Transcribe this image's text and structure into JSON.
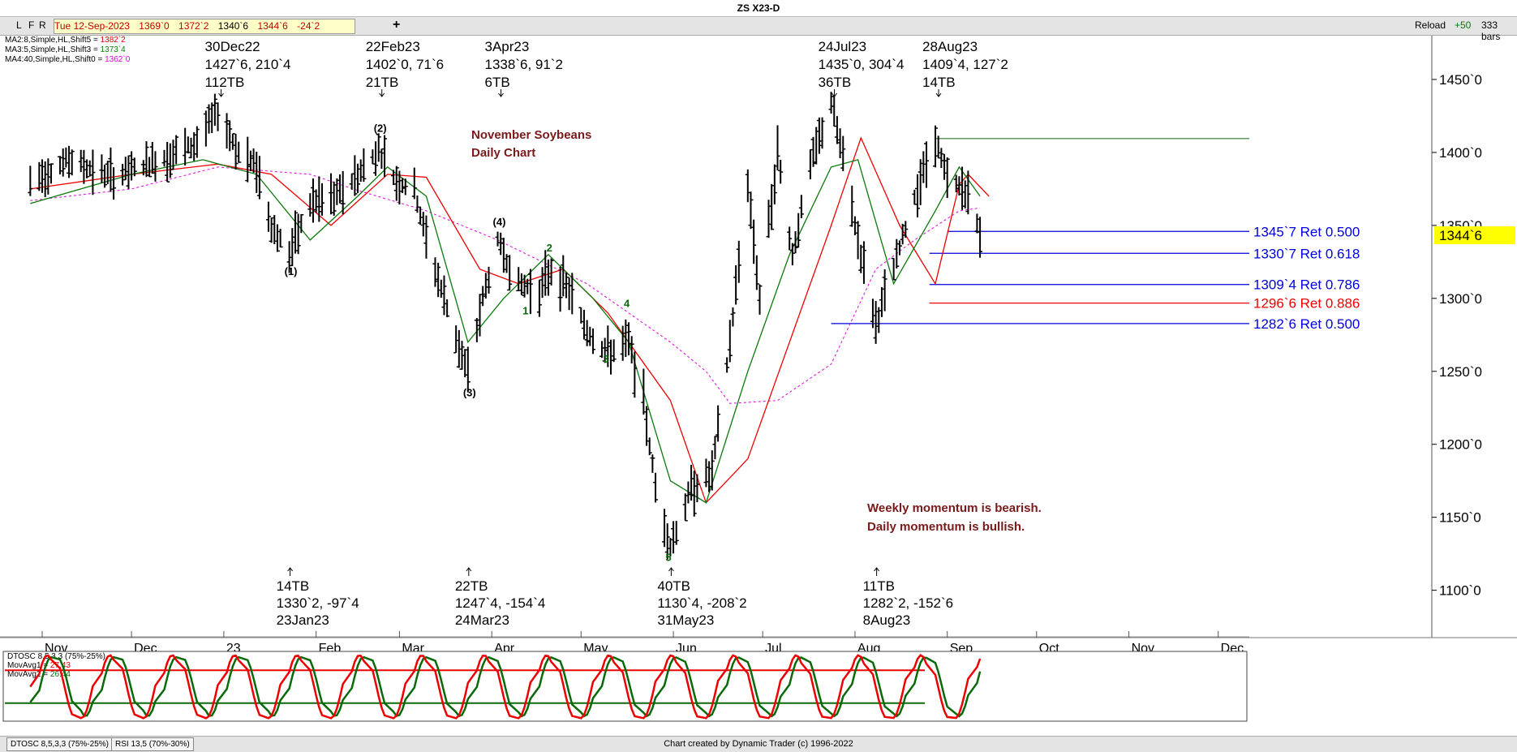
{
  "window": {
    "title": "ZS X23-D"
  },
  "toolbar": {
    "buttons": [
      "L",
      "F",
      "R"
    ],
    "date": "Tue 12-Sep-2023",
    "open": "1369`0",
    "high": "1372`2",
    "low": "1340`6",
    "close": "1344`6",
    "change": "-24`2",
    "add_label": "+",
    "reload_label": "Reload",
    "plus50": "+50",
    "bars_label": "333 bars"
  },
  "legend": {
    "ma2": {
      "label": "MA2:8,Simple,HL,Shift5",
      "value": "1382`2",
      "color": "#e00000"
    },
    "ma3": {
      "label": "MA3:5,Simple,HL,Shift3",
      "value": "1373`4",
      "color": "#0a7a0a"
    },
    "ma4": {
      "label": "MA4:40,Simple,HL,Shift0",
      "value": "1362`0",
      "color": "#e000e0"
    }
  },
  "chart_data": {
    "type": "line",
    "title": "ZS X23-D",
    "subtitle": "November Soybeans Daily Chart",
    "annotation_lines": [
      "November Soybeans",
      "Daily Chart"
    ],
    "ylim": [
      1092,
      1480
    ],
    "yticks": [
      "1450`0",
      "1400`0",
      "1350`0",
      "1300`0",
      "1250`0",
      "1200`0",
      "1150`0",
      "1100`0"
    ],
    "ytick_values": [
      1450,
      1400,
      1350,
      1300,
      1250,
      1200,
      1150,
      1100
    ],
    "months": [
      "Nov",
      "Dec",
      "23",
      "Feb",
      "Mar",
      "Apr",
      "May",
      "Jun",
      "Jul",
      "Aug",
      "Sep",
      "Oct",
      "Nov",
      "Dec"
    ],
    "current_price": "1344`6",
    "price_path": [
      [
        "2022-10-28",
        1380
      ],
      [
        "2022-11-10",
        1395
      ],
      [
        "2022-11-25",
        1383
      ],
      [
        "2022-12-10",
        1395
      ],
      [
        "2022-12-22",
        1405
      ],
      [
        "2022-12-30",
        1427.75
      ],
      [
        "2023-01-06",
        1400
      ],
      [
        "2023-01-12",
        1390
      ],
      [
        "2023-01-17",
        1350
      ],
      [
        "2023-01-23",
        1330.25
      ],
      [
        "2023-01-30",
        1365
      ],
      [
        "2023-02-08",
        1370
      ],
      [
        "2023-02-15",
        1385
      ],
      [
        "2023-02-22",
        1402
      ],
      [
        "2023-02-28",
        1380
      ],
      [
        "2023-03-06",
        1375
      ],
      [
        "2023-03-10",
        1340
      ],
      [
        "2023-03-16",
        1300
      ],
      [
        "2023-03-24",
        1247.5
      ],
      [
        "2023-03-29",
        1300
      ],
      [
        "2023-04-03",
        1338.75
      ],
      [
        "2023-04-10",
        1310
      ],
      [
        "2023-04-17",
        1305
      ],
      [
        "2023-04-21",
        1320
      ],
      [
        "2023-04-27",
        1305
      ],
      [
        "2023-05-03",
        1278
      ],
      [
        "2023-05-10",
        1262
      ],
      [
        "2023-05-17",
        1270
      ],
      [
        "2023-05-22",
        1230
      ],
      [
        "2023-05-26",
        1170
      ],
      [
        "2023-05-31",
        1130.5
      ],
      [
        "2023-06-07",
        1170
      ],
      [
        "2023-06-14",
        1180
      ],
      [
        "2023-06-20",
        1270
      ],
      [
        "2023-06-26",
        1380
      ],
      [
        "2023-06-30",
        1300
      ],
      [
        "2023-07-06",
        1400
      ],
      [
        "2023-07-11",
        1330
      ],
      [
        "2023-07-17",
        1390
      ],
      [
        "2023-07-24",
        1435
      ],
      [
        "2023-07-28",
        1395
      ],
      [
        "2023-08-02",
        1340
      ],
      [
        "2023-08-08",
        1282.25
      ],
      [
        "2023-08-14",
        1320
      ],
      [
        "2023-08-21",
        1370
      ],
      [
        "2023-08-28",
        1409.5
      ],
      [
        "2023-09-01",
        1380
      ],
      [
        "2023-09-07",
        1375
      ],
      [
        "2023-09-12",
        1344.75
      ]
    ],
    "ma_fast_path": [
      [
        "2022-10-28",
        1365
      ],
      [
        "2022-12-01",
        1385
      ],
      [
        "2022-12-25",
        1395
      ],
      [
        "2023-01-12",
        1385
      ],
      [
        "2023-01-30",
        1340
      ],
      [
        "2023-02-15",
        1370
      ],
      [
        "2023-02-25",
        1390
      ],
      [
        "2023-03-10",
        1370
      ],
      [
        "2023-03-24",
        1270
      ],
      [
        "2023-04-05",
        1300
      ],
      [
        "2023-04-20",
        1330
      ],
      [
        "2023-05-05",
        1300
      ],
      [
        "2023-05-17",
        1270
      ],
      [
        "2023-05-31",
        1175
      ],
      [
        "2023-06-12",
        1160
      ],
      [
        "2023-06-26",
        1250
      ],
      [
        "2023-07-10",
        1330
      ],
      [
        "2023-07-24",
        1390
      ],
      [
        "2023-08-02",
        1395
      ],
      [
        "2023-08-14",
        1310
      ],
      [
        "2023-08-28",
        1360
      ],
      [
        "2023-09-05",
        1390
      ],
      [
        "2023-09-12",
        1370
      ]
    ],
    "ma_slow_path": [
      [
        "2022-10-28",
        1375
      ],
      [
        "2022-12-01",
        1385
      ],
      [
        "2022-12-30",
        1392
      ],
      [
        "2023-01-17",
        1385
      ],
      [
        "2023-02-06",
        1350
      ],
      [
        "2023-02-25",
        1385
      ],
      [
        "2023-03-10",
        1383
      ],
      [
        "2023-03-28",
        1320
      ],
      [
        "2023-04-10",
        1310
      ],
      [
        "2023-04-25",
        1320
      ],
      [
        "2023-05-10",
        1290
      ],
      [
        "2023-05-31",
        1230
      ],
      [
        "2023-06-12",
        1160
      ],
      [
        "2023-06-26",
        1190
      ],
      [
        "2023-07-10",
        1270
      ],
      [
        "2023-07-24",
        1350
      ],
      [
        "2023-08-03",
        1410
      ],
      [
        "2023-08-16",
        1350
      ],
      [
        "2023-08-28",
        1310
      ],
      [
        "2023-09-05",
        1378
      ],
      [
        "2023-09-08",
        1385
      ],
      [
        "2023-09-15",
        1370
      ]
    ],
    "ma40_path": [
      [
        "2022-10-28",
        1367
      ],
      [
        "2022-12-01",
        1375
      ],
      [
        "2022-12-30",
        1390
      ],
      [
        "2023-01-30",
        1385
      ],
      [
        "2023-02-15",
        1374
      ],
      [
        "2023-03-10",
        1360
      ],
      [
        "2023-04-03",
        1340
      ],
      [
        "2023-05-03",
        1310
      ],
      [
        "2023-05-31",
        1270
      ],
      [
        "2023-06-12",
        1250
      ],
      [
        "2023-06-20",
        1228
      ],
      [
        "2023-07-06",
        1230
      ],
      [
        "2023-07-24",
        1255
      ],
      [
        "2023-08-08",
        1320
      ],
      [
        "2023-08-21",
        1340
      ],
      [
        "2023-09-05",
        1360
      ],
      [
        "2023-09-12",
        1362
      ]
    ],
    "retracements": [
      {
        "label": "1345`7 Ret 0.500",
        "value": 1345.875,
        "color": "#0000dd",
        "from": "2023-09-01"
      },
      {
        "label": "1330`7 Ret 0.618",
        "value": 1330.875,
        "color": "#0000dd",
        "from": "2023-08-26"
      },
      {
        "label": "1309`4 Ret 0.786",
        "value": 1309.5,
        "color": "#0000dd",
        "from": "2023-08-26"
      },
      {
        "label": "1296`6 Ret 0.886",
        "value": 1296.75,
        "color": "#ee0000",
        "from": "2023-08-26"
      },
      {
        "label": "1282`6 Ret 0.500",
        "value": 1282.75,
        "color": "#0000dd",
        "from": "2023-07-24"
      }
    ],
    "resistance_line": {
      "value": 1409.5,
      "from": "2023-08-28",
      "color": "#2a7a2a"
    },
    "top_annotations": [
      {
        "date": "2022-12-30",
        "lines": [
          "30Dec22",
          "1427`6, 210`4",
          "112TB"
        ]
      },
      {
        "date": "2023-02-22",
        "lines": [
          "22Feb23",
          "1402`0, 71`6",
          "21TB"
        ]
      },
      {
        "date": "2023-04-03",
        "lines": [
          "3Apr23",
          "1338`6, 91`2",
          "6TB"
        ]
      },
      {
        "date": "2023-07-24",
        "lines": [
          "24Jul23",
          "1435`0, 304`4",
          "36TB"
        ]
      },
      {
        "date": "2023-08-28",
        "lines": [
          "28Aug23",
          "1409`4, 127`2",
          "14TB"
        ]
      }
    ],
    "bottom_annotations": [
      {
        "date": "2023-01-23",
        "lines": [
          "14TB",
          "1330`2, -97`4",
          "23Jan23"
        ]
      },
      {
        "date": "2023-03-24",
        "lines": [
          "22TB",
          "1247`4, -154`4",
          "24Mar23"
        ]
      },
      {
        "date": "2023-05-31",
        "lines": [
          "40TB",
          "1130`4, -208`2",
          "31May23"
        ]
      },
      {
        "date": "2023-08-08",
        "lines": [
          "11TB",
          "1282`2, -152`6",
          "8Aug23"
        ]
      }
    ],
    "wave_labels": [
      {
        "text": "(1)",
        "date": "2023-01-23",
        "value": 1316,
        "color": "#000"
      },
      {
        "text": "(2)",
        "date": "2023-02-22",
        "value": 1414,
        "color": "#000"
      },
      {
        "text": "(3)",
        "date": "2023-03-24",
        "value": 1233,
        "color": "#000"
      },
      {
        "text": "(4)",
        "date": "2023-04-03",
        "value": 1350,
        "color": "#000"
      },
      {
        "text": "1",
        "date": "2023-04-13",
        "value": 1289,
        "color": "#0a6a0a"
      },
      {
        "text": "2",
        "date": "2023-04-21",
        "value": 1332,
        "color": "#0a6a0a"
      },
      {
        "text": "3",
        "date": "2023-05-10",
        "value": 1256,
        "color": "#0a6a0a"
      },
      {
        "text": "4",
        "date": "2023-05-17",
        "value": 1294,
        "color": "#0a6a0a"
      },
      {
        "text": "5",
        "date": "2023-05-31",
        "value": 1120,
        "color": "#0a6a0a"
      }
    ],
    "momentum_note": [
      "Weekly momentum is bearish.",
      "Daily momentum is bullish."
    ],
    "dtosc": {
      "legend": {
        "title": "DTOSC 8,5,3,3 (75%-25%)",
        "ma1_label": "MovAvg1",
        "ma1_value": "27.43",
        "ma2_label": "MovAvg2",
        "ma2_value": "26.44"
      },
      "upper": 75,
      "lower": 25,
      "fast_color": "#ee0000",
      "slow_color": "#0a6a0a"
    }
  },
  "bottom_tabs": [
    "DTOSC 8,5,3,3 (75%-25%)",
    "RSI 13,5 (70%-30%)"
  ],
  "footer": {
    "credit": "Chart created by Dynamic Trader  (c) 1996-2022"
  }
}
